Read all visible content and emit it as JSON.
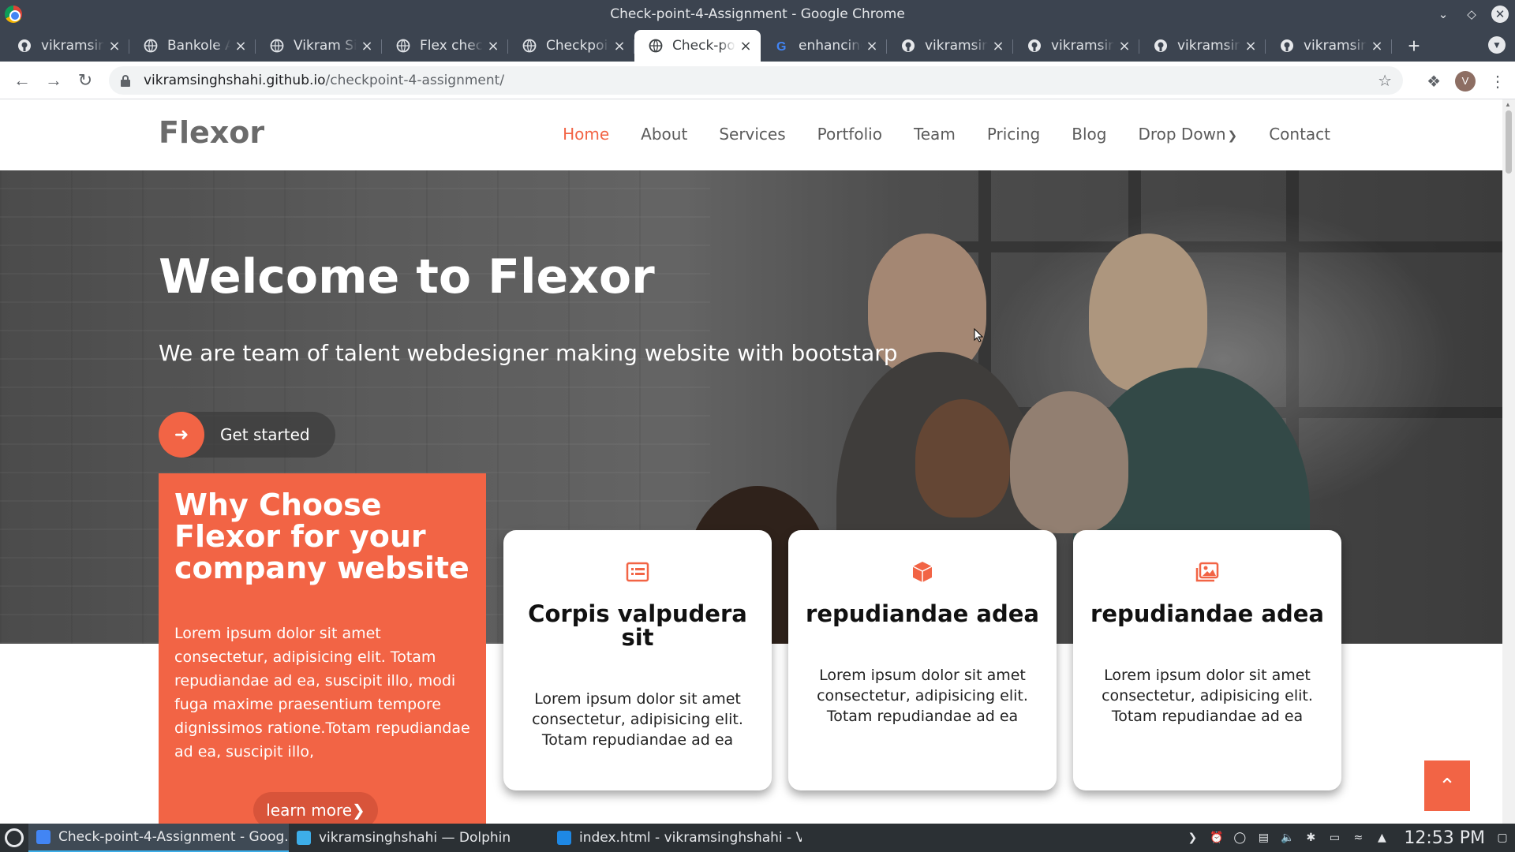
{
  "window": {
    "title": "Check-point-4-Assignment - Google Chrome"
  },
  "tabs": [
    {
      "label": "vikramsingh",
      "icon": "github-icon",
      "active": false
    },
    {
      "label": "Bankole Adebayo",
      "icon": "globe-icon",
      "active": false
    },
    {
      "label": "Vikram Singh",
      "icon": "globe-icon",
      "active": false
    },
    {
      "label": "Flex checkpoint",
      "icon": "globe-icon",
      "active": false
    },
    {
      "label": "Checkpoint",
      "icon": "globe-icon",
      "active": false
    },
    {
      "label": "Check-point",
      "icon": "globe-icon",
      "active": true
    },
    {
      "label": "enhancing",
      "icon": "google-icon",
      "active": false
    },
    {
      "label": "vikramsingh",
      "icon": "github-icon",
      "active": false
    },
    {
      "label": "vikramsingh",
      "icon": "github-icon",
      "active": false
    },
    {
      "label": "vikramsingh",
      "icon": "github-icon",
      "active": false
    },
    {
      "label": "vikramsingh",
      "icon": "github-icon",
      "active": false
    }
  ],
  "address": {
    "host": "vikramsinghshahi.github.io",
    "path": "/checkpoint-4-assignment/"
  },
  "profile": {
    "initial": "V"
  },
  "site": {
    "logo": "Flexor",
    "nav": [
      "Home",
      "About",
      "Services",
      "Portfolio",
      "Team",
      "Pricing",
      "Blog",
      "Drop Down",
      "Contact"
    ],
    "hero": {
      "title": "Welcome to Flexor",
      "subtitle": "We are team of talent webdesigner making website with bootstarp",
      "cta": "Get started"
    },
    "why": {
      "title": "Why Choose Flexor for your company website",
      "text": "Lorem ipsum dolor sit amet consectetur, adipisicing elit. Totam repudiandae ad ea, suscipit illo, modi fuga maxime praesentium tempore dignissimos ratione.Totam repudiandae ad ea, suscipit illo,",
      "button": "learn more"
    },
    "cards": [
      {
        "title": "Corpis valpudera sit",
        "text": "Lorem ipsum dolor sit amet consectetur, adipisicing elit. Totam repudiandae ad ea",
        "icon": "list-icon"
      },
      {
        "title": "repudiandae adea",
        "text": "Lorem ipsum dolor sit amet consectetur, adipisicing elit. Totam repudiandae ad ea",
        "icon": "cube-icon"
      },
      {
        "title": "repudiandae adea",
        "text": "Lorem ipsum dolor sit amet consectetur, adipisicing elit. Totam repudiandae ad ea",
        "icon": "images-icon"
      }
    ]
  },
  "taskbar": {
    "tasks": [
      {
        "label": "Check-point-4-Assignment - Goog...",
        "icon": "chrome-icon",
        "active": true
      },
      {
        "label": "vikramsinghshahi — Dolphin",
        "icon": "folder-icon",
        "active": false
      },
      {
        "label": "index.html - vikramsinghshahi - Vi...",
        "icon": "vscode-icon",
        "active": false
      }
    ],
    "clock": "12:53 PM"
  },
  "colors": {
    "accent": "#f26445",
    "chrome_frame": "#3c4450",
    "taskbar": "#2b3034"
  }
}
